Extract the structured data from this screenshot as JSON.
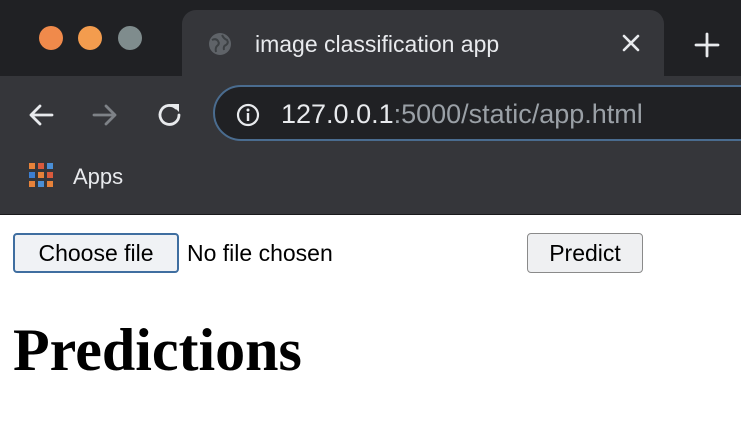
{
  "window": {
    "traffic_lights": {
      "close": "#f08a4b",
      "minimize": "#f39c4e",
      "maximize": "#7f8c8d"
    }
  },
  "tab": {
    "title": "image classification app",
    "favicon": "globe-icon",
    "close_icon": "close-icon"
  },
  "toolbar": {
    "back_icon": "arrow-left-icon",
    "forward_icon": "arrow-right-icon",
    "reload_icon": "reload-icon",
    "site_info_icon": "info-icon",
    "url_host": "127.0.0.1",
    "url_rest": ":5000/static/app.html"
  },
  "bookmarks": {
    "apps_label": "Apps",
    "apps_icon": "apps-grid-icon"
  },
  "page": {
    "choose_file_label": "Choose file",
    "file_status": "No file chosen",
    "predict_label": "Predict",
    "heading": "Predictions"
  },
  "colors": {
    "tabstrip_bg": "#202124",
    "toolbar_bg": "#35363a",
    "omnibox_border": "#4a6c8f"
  }
}
